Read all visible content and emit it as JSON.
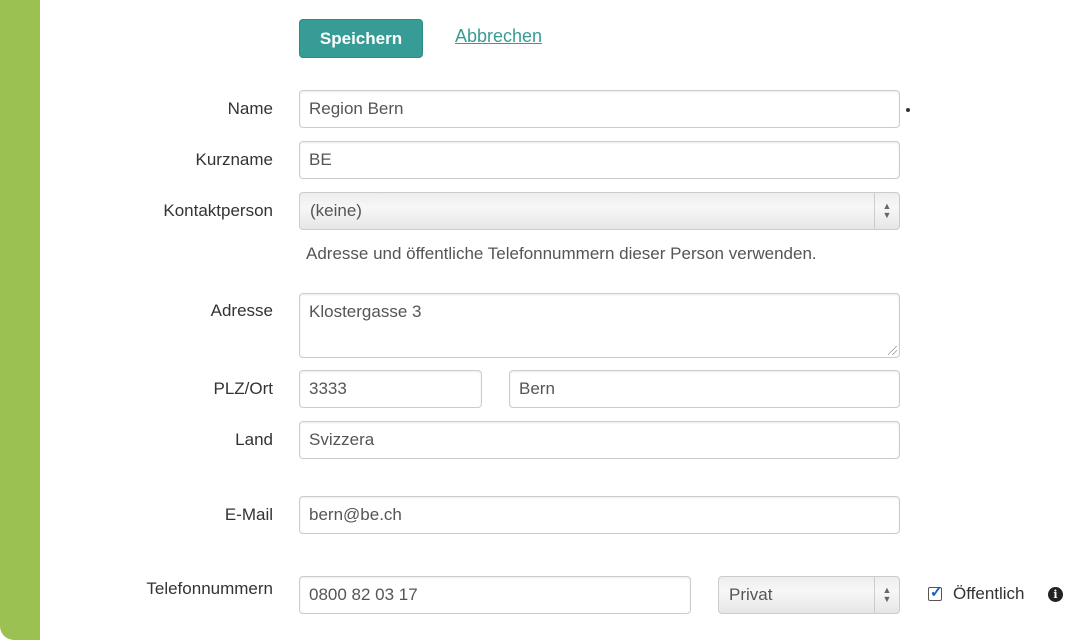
{
  "actions": {
    "save_label": "Speichern",
    "cancel_label": "Abbrechen"
  },
  "form": {
    "name": {
      "label": "Name",
      "value": "Region Bern"
    },
    "short_name": {
      "label": "Kurzname",
      "value": "BE"
    },
    "contact": {
      "label": "Kontaktperson",
      "selected": "(keine)",
      "help": "Adresse und öffentliche Telefonnummern dieser Person verwenden."
    },
    "address": {
      "label": "Adresse",
      "value": "Klostergasse 3"
    },
    "zip_city": {
      "label": "PLZ/Ort",
      "zip": "3333",
      "city": "Bern"
    },
    "country": {
      "label": "Land",
      "value": "Svizzera"
    },
    "email": {
      "label": "E-Mail",
      "value": "bern@be.ch"
    },
    "phone": {
      "label": "Telefonnummern",
      "number": "0800 82 03 17",
      "type": "Privat",
      "public_label": "Öffentlich",
      "public_checked": true
    }
  },
  "icons": {
    "info": "info-circle-icon",
    "select_arrows": "up-down-arrows-icon",
    "check": "checkmark-icon"
  },
  "colors": {
    "accent": "#379c96",
    "sidebar": "#9ac152"
  }
}
